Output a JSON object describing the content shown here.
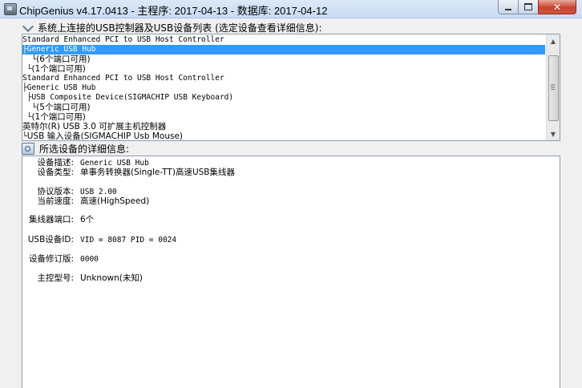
{
  "window": {
    "title": "ChipGenius v4.17.0413 - 主程序: 2017-04-13 - 数据库: 2017-04-12",
    "close_glyph": "✕"
  },
  "device_list": {
    "header": "系统上连接的USB控制器及USB设备列表 (选定设备查看详细信息):",
    "items": [
      {
        "prefix": "",
        "text": "Standard Enhanced PCI to USB Host Controller"
      },
      {
        "prefix": "├",
        "text": "Generic USB Hub",
        "selected": true
      },
      {
        "prefix": "  └",
        "text": "(6个端口可用)"
      },
      {
        "prefix": " └",
        "text": "(1个端口可用)"
      },
      {
        "prefix": "",
        "text": "Standard Enhanced PCI to USB Host Controller"
      },
      {
        "prefix": "├",
        "text": "Generic USB Hub"
      },
      {
        "prefix": " ├",
        "text": "USB Composite Device(SIGMACHIP USB Keyboard)"
      },
      {
        "prefix": "  └",
        "text": "(5个端口可用)"
      },
      {
        "prefix": " └",
        "text": "(1个端口可用)"
      },
      {
        "prefix": "",
        "text": "英特尔(R) USB 3.0 可扩展主机控制器"
      },
      {
        "prefix": "└",
        "text": "USB 输入设备(SIGMACHIP Usb Mouse)"
      }
    ]
  },
  "details": {
    "header": "所选设备的详细信息:",
    "rows": [
      {
        "label": "设备描述:",
        "value": "Generic USB Hub"
      },
      {
        "label": "设备类型:",
        "value": "单事务转换器(Single-TT)高速USB集线器"
      },
      {
        "label": "协议版本:",
        "value": "USB 2.00"
      },
      {
        "label": "当前速度:",
        "value": "高速(HighSpeed)"
      },
      {
        "label": "集线器端口:",
        "value": "6个"
      },
      {
        "label": "USB设备ID:",
        "value": "VID = 8087 PID = 0024"
      },
      {
        "label": "设备修订版:",
        "value": "0000"
      },
      {
        "label": "主控型号:",
        "value": "Unknown(未知)"
      }
    ]
  }
}
